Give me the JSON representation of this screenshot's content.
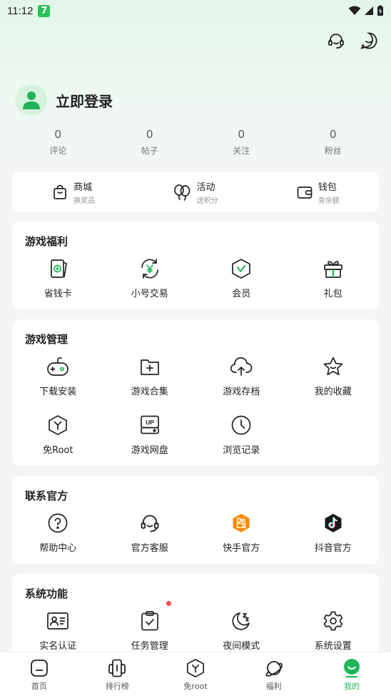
{
  "status_bar": {
    "time": "11:12",
    "app_badge": "7"
  },
  "profile": {
    "login_label": "立即登录"
  },
  "stats": [
    {
      "value": "0",
      "label": "评论"
    },
    {
      "value": "0",
      "label": "帖子"
    },
    {
      "value": "0",
      "label": "关注"
    },
    {
      "value": "0",
      "label": "粉丝"
    }
  ],
  "quick_links": [
    {
      "title": "商城",
      "subtitle": "换奖品",
      "icon": "shopping-bag-icon"
    },
    {
      "title": "活动",
      "subtitle": "送积分",
      "icon": "balloon-icon"
    },
    {
      "title": "钱包",
      "subtitle": "查余额",
      "icon": "wallet-icon"
    }
  ],
  "game_welfare": {
    "title": "游戏福利",
    "items": [
      {
        "label": "省钱卡",
        "icon": "savings-card-icon"
      },
      {
        "label": "小号交易",
        "icon": "yuan-exchange-icon"
      },
      {
        "label": "会员",
        "icon": "vip-hexagon-icon"
      },
      {
        "label": "礼包",
        "icon": "gift-icon"
      }
    ]
  },
  "game_management": {
    "title": "游戏管理",
    "items": [
      {
        "label": "下载安装",
        "icon": "gamepad-icon"
      },
      {
        "label": "游戏合集",
        "icon": "folder-add-icon"
      },
      {
        "label": "游戏存档",
        "icon": "cloud-upload-icon"
      },
      {
        "label": "我的收藏",
        "icon": "star-icon"
      },
      {
        "label": "免Root",
        "icon": "root-hexagon-icon"
      },
      {
        "label": "游戏网盘",
        "icon": "cloud-disk-icon",
        "badge_text": "UP"
      },
      {
        "label": "浏览记录",
        "icon": "clock-icon"
      }
    ]
  },
  "official_contact": {
    "title": "联系官方",
    "items": [
      {
        "label": "帮助中心",
        "icon": "help-icon"
      },
      {
        "label": "官方客服",
        "icon": "headset-icon"
      },
      {
        "label": "快手官方",
        "icon": "kuaishou-icon"
      },
      {
        "label": "抖音官方",
        "icon": "douyin-icon"
      }
    ]
  },
  "system_functions": {
    "title": "系统功能",
    "items": [
      {
        "label": "实名认证",
        "icon": "id-card-icon"
      },
      {
        "label": "任务管理",
        "icon": "clipboard-check-icon"
      },
      {
        "label": "夜间模式",
        "icon": "moon-icon"
      },
      {
        "label": "系统设置",
        "icon": "gear-icon"
      }
    ]
  },
  "bottom_nav": [
    {
      "label": "首页",
      "icon": "home-icon",
      "active": false
    },
    {
      "label": "排行榜",
      "icon": "ranking-icon",
      "active": false
    },
    {
      "label": "免root",
      "icon": "root-hexagon-icon",
      "active": false
    },
    {
      "label": "福利",
      "icon": "planet-icon",
      "active": false
    },
    {
      "label": "我的",
      "icon": "profile-icon",
      "active": true
    }
  ],
  "colors": {
    "accent": "#1fb55a",
    "badge": "#2bc25a",
    "kuaishou": "#ff8a00",
    "douyin": "#1a1a1a",
    "notification": "#f05050"
  }
}
